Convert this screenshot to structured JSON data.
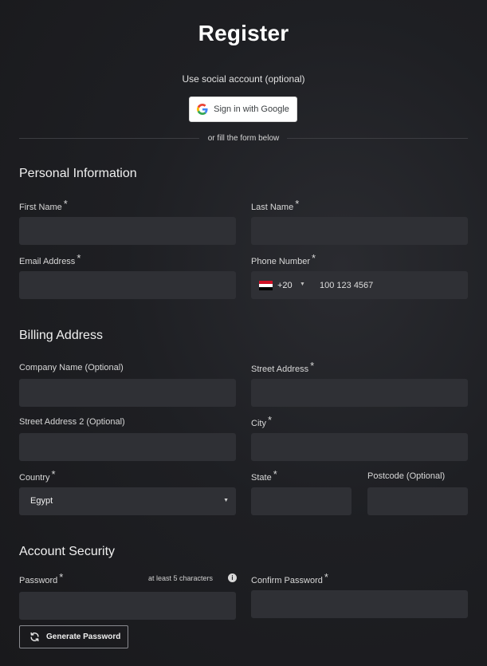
{
  "page": {
    "title": "Register"
  },
  "social": {
    "caption": "Use social account (optional)",
    "google_label": "Sign in with Google",
    "divider_text": "or fill the form below"
  },
  "personal": {
    "section_title": "Personal Information",
    "first_name_label": "First Name",
    "last_name_label": "Last Name",
    "email_label": "Email Address",
    "phone_label": "Phone Number",
    "phone_country_code": "+20",
    "phone_placeholder": "100 123 4567",
    "phone_flag": "egypt-flag-icon"
  },
  "billing": {
    "section_title": "Billing Address",
    "company_label": "Company Name (Optional)",
    "street_label": "Street Address",
    "street2_label": "Street Address 2 (Optional)",
    "city_label": "City",
    "country_label": "Country",
    "country_value": "Egypt",
    "state_label": "State",
    "postcode_label": "Postcode (Optional)"
  },
  "security": {
    "section_title": "Account Security",
    "password_label": "Password",
    "password_hint": "at least 5 characters",
    "confirm_label": "Confirm Password",
    "generate_label": "Generate Password"
  },
  "required_marker": "*",
  "colors": {
    "background": "#1e1f23",
    "field": "#2f3035",
    "text": "#e6e6e6"
  }
}
